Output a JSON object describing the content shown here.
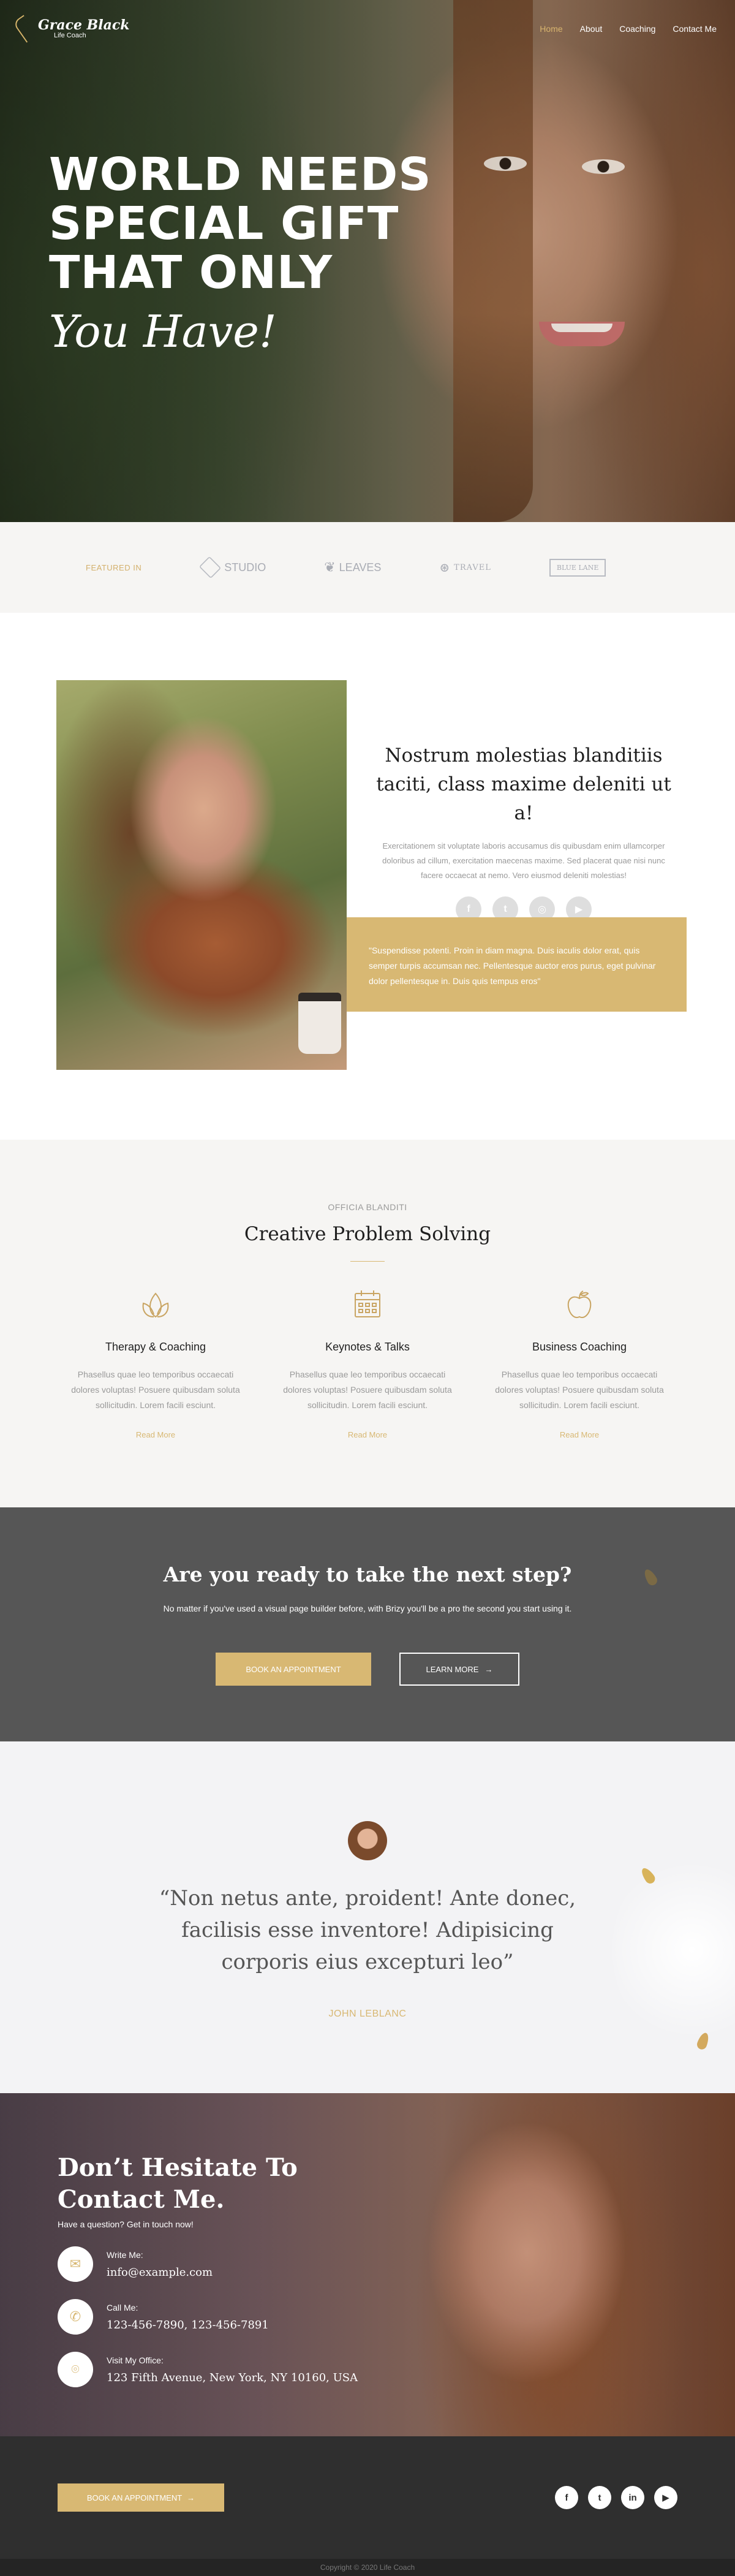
{
  "nav": {
    "logo_name": "Grace Black",
    "logo_sub": "Life Coach",
    "links": [
      "Home",
      "About",
      "Coaching",
      "Contact Me"
    ]
  },
  "hero": {
    "line1": "WORLD NEEDS",
    "line2": "SPECIAL GIFT",
    "line3": "THAT ONLY",
    "script": "You Have!"
  },
  "featured": {
    "label": "FEATURED IN",
    "logos": [
      "STUDIO",
      "LEAVES",
      "TRAVEL",
      "BLUE LANE"
    ]
  },
  "about": {
    "title": "Nostrum molestias blanditiis taciti, class maxime deleniti ut a!",
    "body": "Exercitationem sit voluptate laboris accusamus dis quibusdam enim ullamcorper doloribus ad cillum, exercitation maecenas maxime. Sed placerat quae nisi nunc facere occaecat at nemo. Vero eiusmod deleniti molestias!",
    "socials": [
      "facebook-icon",
      "twitter-icon",
      "instagram-icon",
      "youtube-icon"
    ],
    "quote": "\"Suspendisse potenti. Proin in diam magna. Duis iaculis dolor erat, quis semper turpis accumsan nec. Pellentesque auctor eros purus, eget pulvinar dolor pellentesque in. Duis quis tempus eros\""
  },
  "services": {
    "kicker": "OFFICIA BLANDITI",
    "title": "Creative Problem Solving",
    "items": [
      {
        "icon": "lotus-icon",
        "title": "Therapy & Coaching",
        "text": "Phasellus quae leo temporibus occaecati dolores voluptas! Posuere quibusdam soluta sollicitudin. Lorem facili esciunt.",
        "link": "Read More"
      },
      {
        "icon": "calendar-icon",
        "title": "Keynotes & Talks",
        "text": "Phasellus quae leo temporibus occaecati dolores voluptas! Posuere quibusdam soluta sollicitudin. Lorem facili esciunt.",
        "link": "Read More"
      },
      {
        "icon": "apple-icon",
        "title": "Business Coaching",
        "text": "Phasellus quae leo temporibus occaecati dolores voluptas! Posuere quibusdam soluta sollicitudin. Lorem facili esciunt.",
        "link": "Read More"
      }
    ]
  },
  "cta": {
    "title": "Are you ready to take the next step?",
    "text": "No matter if you've used a visual page builder before, with Brizy you'll be a pro the second you start using it.",
    "primary": "BOOK AN APPOINTMENT",
    "secondary": "LEARN MORE",
    "secondary_icon": "arrow-right-icon"
  },
  "testimonial": {
    "quote": "“Non netus ante, proident! Ante donec, facilisis esse inventore! Adipisicing corporis eius excepturi leo”",
    "name": "JOHN LEBLANC"
  },
  "contact": {
    "title_line1": "Don’t Hesitate To",
    "title_line2": "Contact Me.",
    "sub": "Have a question? Get in touch now!",
    "rows": [
      {
        "icon": "envelope-icon",
        "label": "Write Me:",
        "value": "info@example.com"
      },
      {
        "icon": "phone-icon",
        "label": "Call Me:",
        "value": "123-456-7890, 123-456-7891"
      },
      {
        "icon": "location-pin-icon",
        "label": "Visit My Office:",
        "value": "123 Fifth Avenue, New York, NY 10160, USA"
      }
    ]
  },
  "footer": {
    "button": "BOOK AN APPOINTMENT",
    "socials": [
      "facebook-icon",
      "twitter-icon",
      "linkedin-icon",
      "youtube-icon"
    ],
    "copyright": "Copyright © 2020 Life Coach"
  },
  "colors": {
    "accent": "#d8b873",
    "dark": "#565656",
    "footer": "#2f2f2f",
    "light_bg": "#f6f5f3"
  }
}
